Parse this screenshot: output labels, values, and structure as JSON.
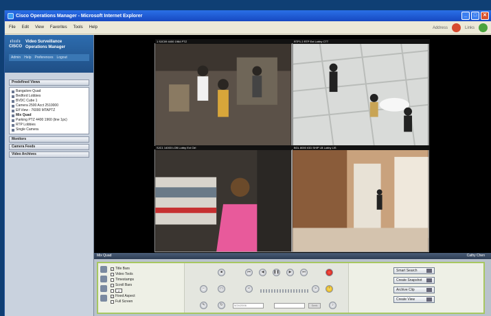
{
  "window": {
    "title": "Cisco Operations Manager - Microsoft Internet Explorer",
    "minimize": "_",
    "maximize": "□",
    "close": "✕"
  },
  "menu": {
    "items": [
      "File",
      "Edit",
      "View",
      "Favorites",
      "Tools",
      "Help"
    ],
    "address_label": "Address",
    "links_label": "Links"
  },
  "brand": {
    "logo_bars": "ılıılı",
    "logo_text": "CISCO",
    "product_line1": "Video Surveillance",
    "product_line2": "Operations Manager",
    "nav": [
      "Admin",
      "Help",
      "Preferences",
      "Logout"
    ]
  },
  "sidebar": {
    "sections": {
      "predefined_views": "Predefined Views",
      "monitors": "Monitors",
      "camera_feeds": "Camera Feeds",
      "video_archives": "Video Archives"
    },
    "views": [
      {
        "label": "Bangalore Quad",
        "bold": false
      },
      {
        "label": "Bedford Lobbies",
        "bold": false
      },
      {
        "label": "BVDC Cube 1",
        "bold": false
      },
      {
        "label": "Camera 2500 Acct 2510000",
        "bold": false
      },
      {
        "label": "Elf View - 76000 MTAPTZ",
        "bold": false
      },
      {
        "label": "Mix Quad",
        "bold": true
      },
      {
        "label": "Parking PTZ 4400 1960 (line 1pc)",
        "bold": false
      },
      {
        "label": "RTP Lobbies",
        "bold": false
      },
      {
        "label": "Single Camera",
        "bold": false
      }
    ]
  },
  "tiles": [
    {
      "label": "1 SJC09 4400 1964 PTZ"
    },
    {
      "label": "RTP1 2 RTP Ext Lobby CTT"
    },
    {
      "label": "SJC1 14003 LOB Lobby Ext Ctrl"
    },
    {
      "label": "BGL 8000 IGD SHIP LB Lobby LIS"
    }
  ],
  "control": {
    "view_name": "Mix Quad",
    "right_label": "Cathy Chen",
    "options": [
      {
        "label": "Title Bars",
        "checked": true
      },
      {
        "label": "Video Tools",
        "checked": false
      },
      {
        "label": "Timestamps",
        "checked": false
      },
      {
        "label": "Scroll Bars",
        "checked": false
      },
      {
        "label": "",
        "checked": false,
        "pager": "2"
      },
      {
        "label": "Fixed Aspect",
        "checked": true
      },
      {
        "label": "Full Screen",
        "checked": false
      }
    ],
    "date_value": "5/24/2006",
    "time_value": "",
    "go_label": "Seek",
    "actions": [
      "Smart Search",
      "Create Snapshot",
      "Archive Clip",
      "Create View"
    ]
  }
}
